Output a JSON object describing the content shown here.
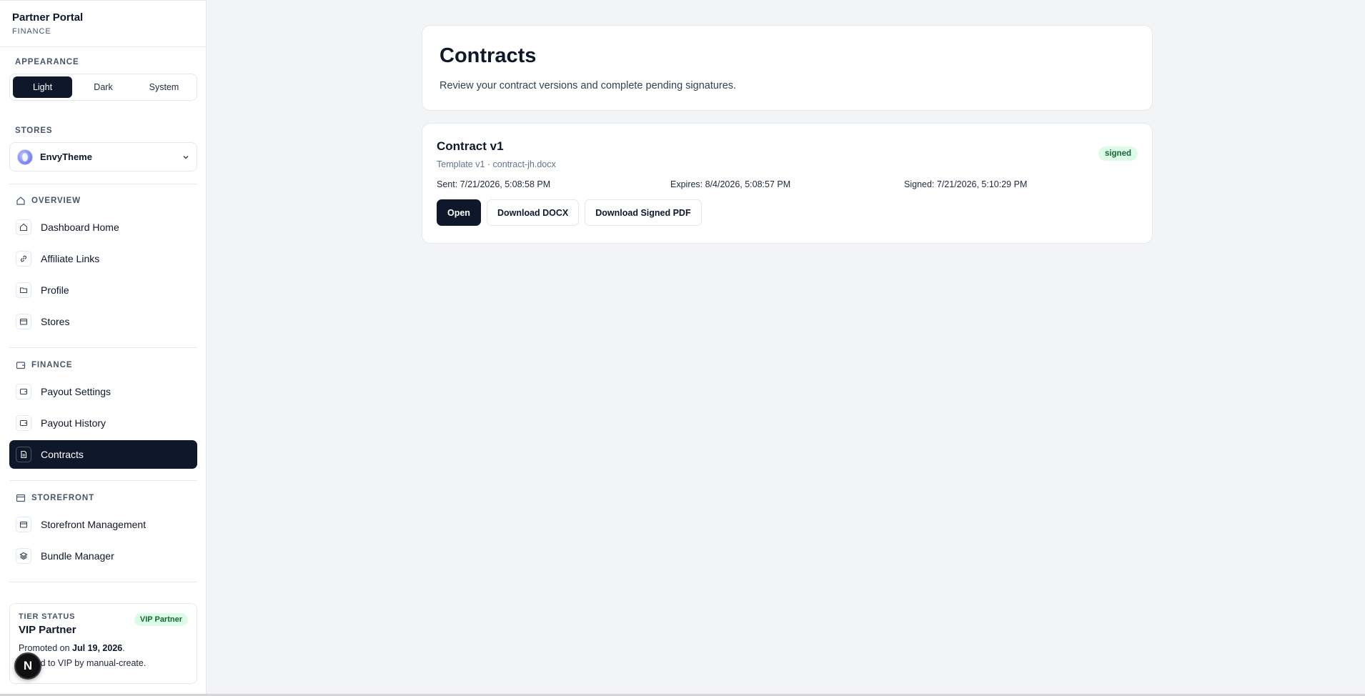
{
  "sidebar": {
    "brand_title": "Partner Portal",
    "brand_subtitle": "FINANCE",
    "appearance_label": "APPEARANCE",
    "appearance_options": [
      "Light",
      "Dark",
      "System"
    ],
    "appearance_selected": "Light",
    "stores_label": "STORES",
    "store_selected": "EnvyTheme",
    "groups": {
      "overview": {
        "label": "OVERVIEW",
        "items": [
          "Dashboard Home",
          "Affiliate Links",
          "Profile",
          "Stores"
        ]
      },
      "finance": {
        "label": "FINANCE",
        "items": [
          "Payout Settings",
          "Payout History",
          "Contracts"
        ]
      },
      "storefront": {
        "label": "STOREFRONT",
        "items": [
          "Storefront Management",
          "Bundle Manager"
        ]
      }
    },
    "active_item": "Contracts",
    "tier": {
      "label": "TIER STATUS",
      "name": "VIP Partner",
      "badge": "VIP Partner",
      "promoted_prefix": "Promoted on ",
      "promoted_date": "Jul 19, 2026",
      "promoted_suffix": ".",
      "note": "Moved to VIP by manual-create."
    },
    "floating_badge": "N"
  },
  "header": {
    "title": "Contracts",
    "subtitle": "Review your contract versions and complete pending signatures."
  },
  "contract": {
    "title": "Contract v1",
    "subtitle": "Template v1 · contract-jh.docx",
    "status": "signed",
    "sent": "Sent: 7/21/2026, 5:08:58 PM",
    "expires": "Expires: 8/4/2026, 5:08:57 PM",
    "signed": "Signed: 7/21/2026, 5:10:29 PM",
    "actions": {
      "open": "Open",
      "download_docx": "Download DOCX",
      "download_signed_pdf": "Download Signed PDF"
    }
  },
  "colors": {
    "primary": "#0f172a",
    "badge_bg": "#dcfce7",
    "badge_text": "#166534",
    "background": "#f3f4f6"
  }
}
